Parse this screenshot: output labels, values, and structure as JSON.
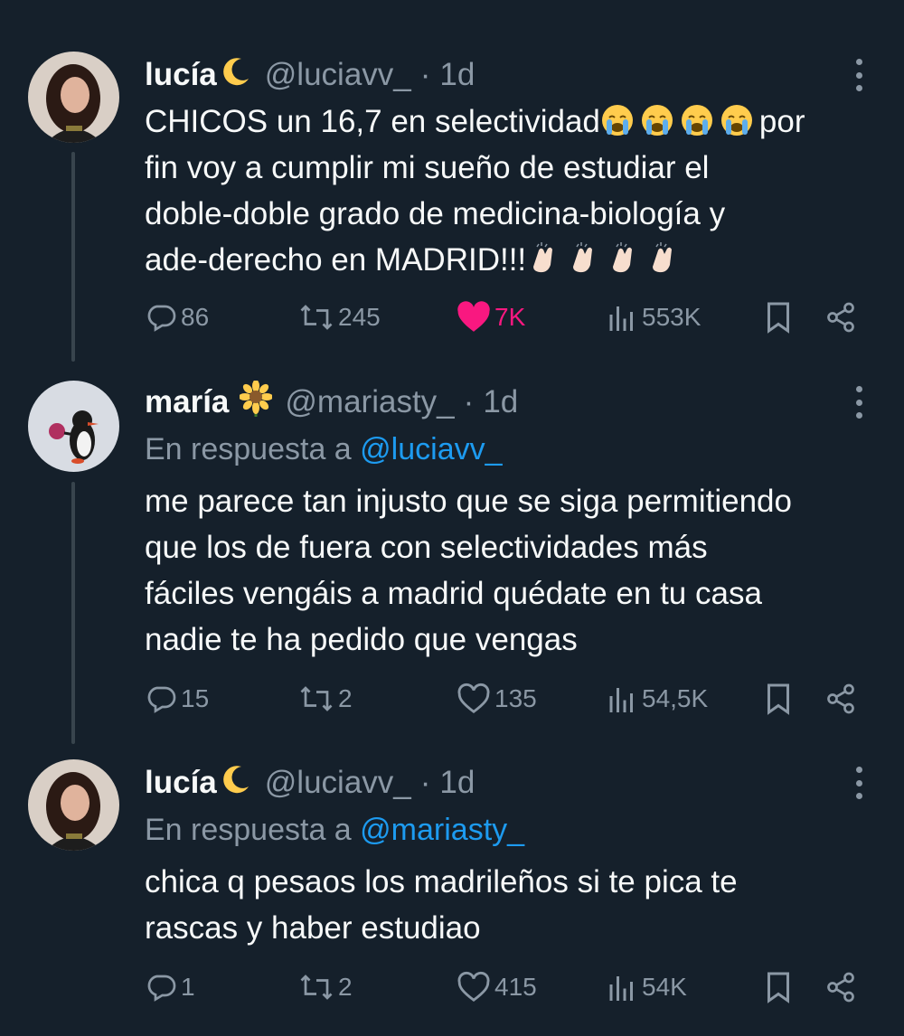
{
  "tweets": [
    {
      "name": "lucía",
      "handle": "@luciavv_",
      "dot": "·",
      "time": "1d",
      "reply_prefix": "",
      "reply_mention": "",
      "text_lines": [
        "CHICOS un 16,7 en selectividad",
        "fin voy a cumplir mi sueño de estudiar el",
        "doble-doble grado de medicina-biología y",
        "ade-derecho en MADRID!!!"
      ],
      "text_word_after_emoji": "por",
      "replies": "86",
      "retweets": "245",
      "likes": "7K",
      "liked": true,
      "views": "553K",
      "name_emoji": "crescent-moon-emoji",
      "avatar": "avatar-photo"
    },
    {
      "name": "maría",
      "handle": "@mariasty_",
      "dot": "·",
      "time": "1d",
      "reply_prefix": "En respuesta a ",
      "reply_mention": "@luciavv_",
      "text_lines": [
        "me parece tan injusto que se siga permitiendo",
        "que los de fuera con selectividades más",
        "fáciles vengáis a madrid quédate en tu casa",
        "nadie te ha pedido que vengas"
      ],
      "replies": "15",
      "retweets": "2",
      "likes": "135",
      "liked": false,
      "views": "54,5K",
      "name_emoji": "sunflower-emoji",
      "avatar": "penguin-avatar"
    },
    {
      "name": "lucía",
      "handle": "@luciavv_",
      "dot": "·",
      "time": "1d",
      "reply_prefix": "En respuesta a ",
      "reply_mention": "@mariasty_",
      "text_lines": [
        "chica q pesaos los madrileños si te pica te",
        "rascas y haber estudiao"
      ],
      "replies": "1",
      "retweets": "2",
      "likes": "415",
      "liked": false,
      "views": "54K",
      "name_emoji": "crescent-moon-emoji",
      "avatar": "avatar-photo"
    }
  ],
  "colors": {
    "background": "#15202b",
    "text": "#f7f9f9",
    "secondary": "#8b98a5",
    "accent": "#1d9bf0",
    "like": "#f91880"
  }
}
